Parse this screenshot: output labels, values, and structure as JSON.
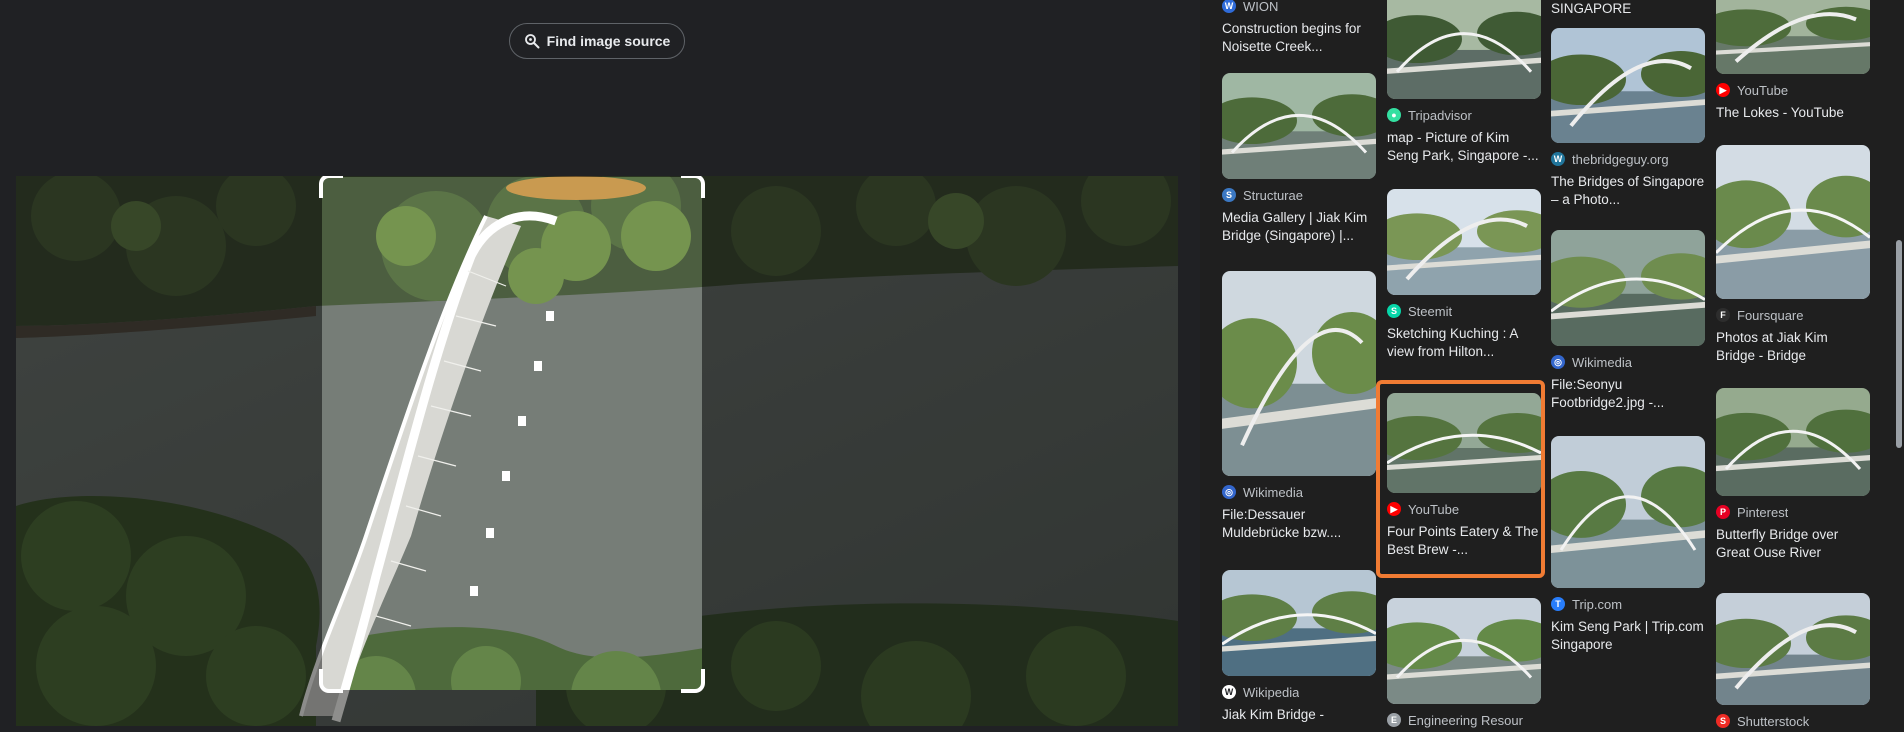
{
  "toolbar": {
    "find_source_label": "Find image source"
  },
  "crop": {
    "selection": "bridge"
  },
  "results": [
    {
      "source": "WION",
      "title": "Construction begins for Noisette Creek...",
      "icon": "wion-icon",
      "icon_color": "#2f6bd8"
    },
    {
      "source": "Structurae",
      "title": "Media Gallery | Jiak Kim Bridge (Singapore) |...",
      "icon": "structurae-icon",
      "icon_color": "#3b78c3"
    },
    {
      "source": "Wikimedia",
      "title": "File:Dessauer Muldebrücke bzw....",
      "icon": "wikimedia-icon",
      "icon_color": "#3366cc"
    },
    {
      "source": "Wikipedia",
      "title": "Jiak Kim Bridge -",
      "icon": "wikipedia-icon",
      "icon_color": "#ffffff"
    },
    {
      "source": "Tripadvisor",
      "title": "map - Picture of Kim Seng Park, Singapore -...",
      "icon": "tripadvisor-icon",
      "icon_color": "#34e0a1"
    },
    {
      "source": "Steemit",
      "title": "Sketching Kuching : A view from Hilton...",
      "icon": "steemit-icon",
      "icon_color": "#06d6a9"
    },
    {
      "source": "YouTube",
      "title": "Four Points Eatery & The Best Brew -...",
      "icon": "youtube-icon",
      "icon_color": "#ff0000"
    },
    {
      "source": "Engineering Resour",
      "title": "",
      "icon": "engineering-icon",
      "icon_color": "#9aa0a6"
    },
    {
      "source": "",
      "title": "SINGAPORE",
      "icon": "",
      "icon_color": "#9aa0a6"
    },
    {
      "source": "thebridgeguy.org",
      "title": "The Bridges of Singapore – a Photo...",
      "icon": "wordpress-icon",
      "icon_color": "#21759b"
    },
    {
      "source": "Wikimedia",
      "title": "File:Seonyu Footbridge2.jpg -...",
      "icon": "wikimedia-icon",
      "icon_color": "#3366cc"
    },
    {
      "source": "Trip.com",
      "title": "Kim Seng Park | Trip.com Singapore",
      "icon": "tripcom-icon",
      "icon_color": "#287dfa"
    },
    {
      "source": "YouTube",
      "title": "The Lokes - YouTube",
      "icon": "youtube-icon",
      "icon_color": "#ff0000"
    },
    {
      "source": "Foursquare",
      "title": "Photos at Jiak Kim Bridge - Bridge",
      "icon": "foursquare-icon",
      "icon_color": "#2d2d2d"
    },
    {
      "source": "Pinterest",
      "title": "Butterfly Bridge over Great Ouse River",
      "icon": "pinterest-icon",
      "icon_color": "#e60023"
    },
    {
      "source": "Shutterstock",
      "title": "",
      "icon": "shutterstock-icon",
      "icon_color": "#ee2b24"
    }
  ]
}
